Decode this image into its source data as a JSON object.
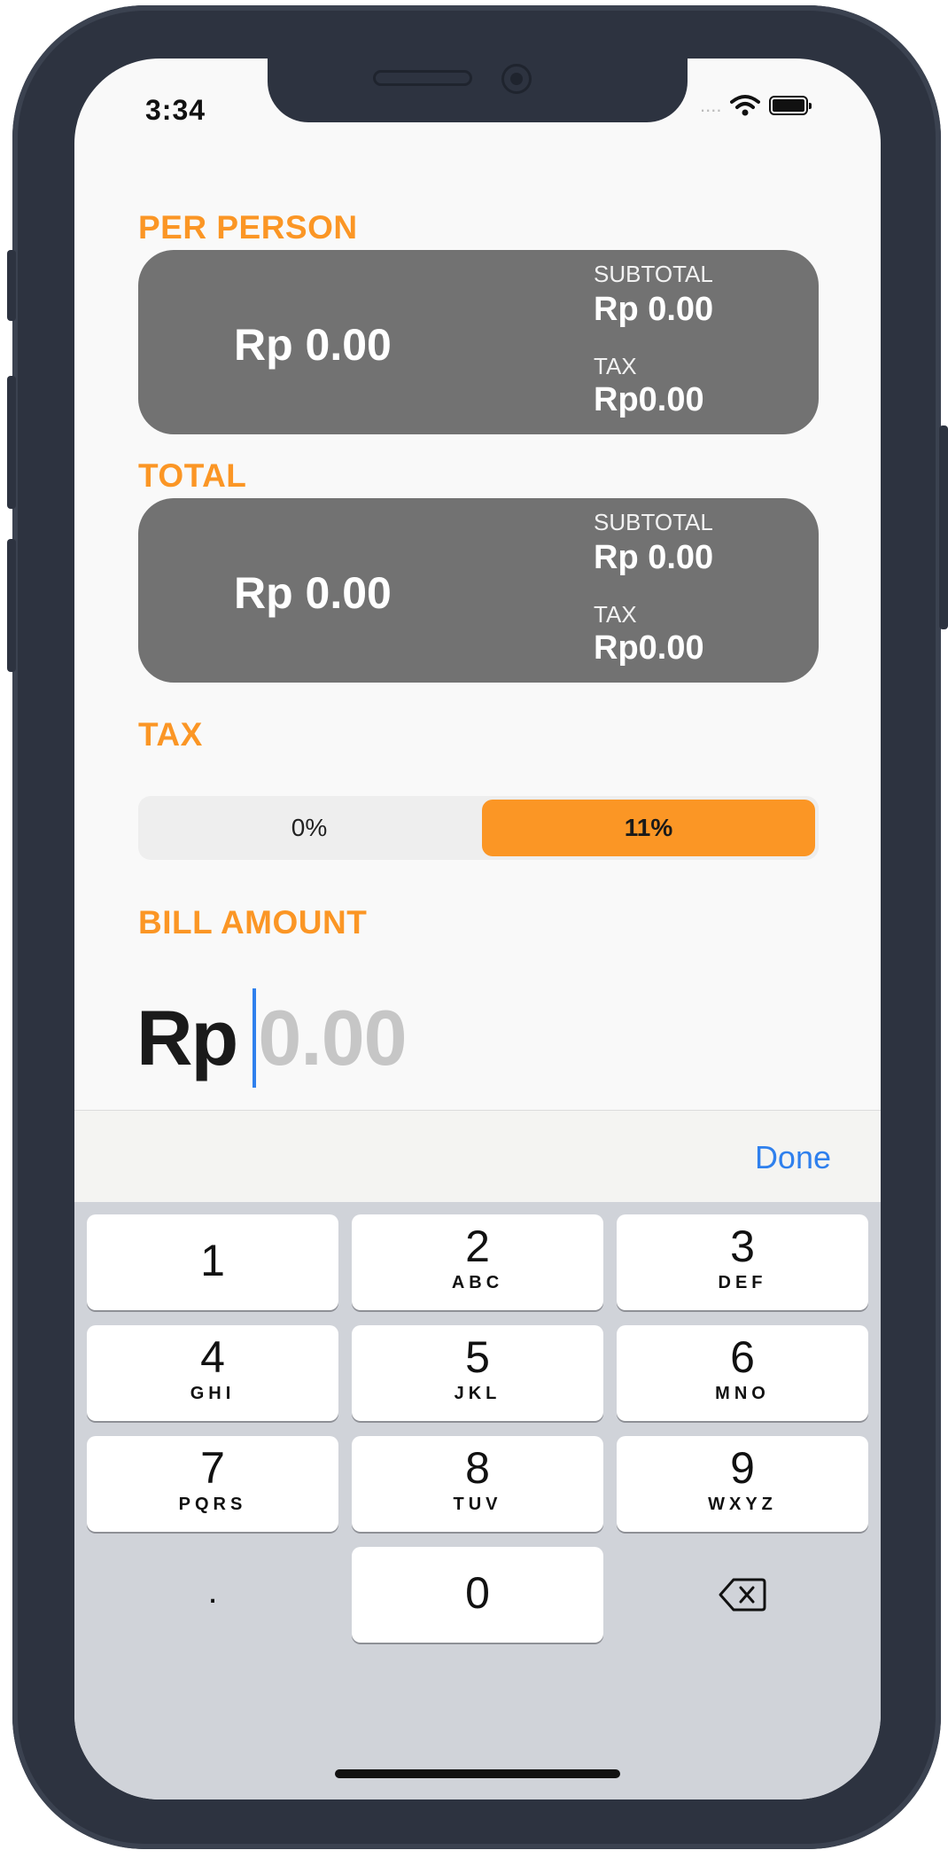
{
  "status_bar": {
    "time": "3:34",
    "signal": "....",
    "wifi_icon": "wifi-icon",
    "battery_icon": "battery-icon"
  },
  "per_person": {
    "label": "PER PERSON",
    "total": "Rp 0.00",
    "subtotal_label": "SUBTOTAL",
    "subtotal_value": "Rp 0.00",
    "tax_label": "TAX",
    "tax_value": "Rp0.00"
  },
  "total": {
    "label": "TOTAL",
    "total": "Rp 0.00",
    "subtotal_label": "SUBTOTAL",
    "subtotal_value": "Rp 0.00",
    "tax_label": "TAX",
    "tax_value": "Rp0.00"
  },
  "tax": {
    "label": "TAX",
    "options": [
      "0%",
      "11%"
    ],
    "selected": "11%"
  },
  "bill": {
    "label": "BILL AMOUNT",
    "currency": "Rp",
    "placeholder": "0.00"
  },
  "accessory": {
    "done_label": "Done"
  },
  "keypad": {
    "keys": [
      {
        "num": "1",
        "letters": ""
      },
      {
        "num": "2",
        "letters": "ABC"
      },
      {
        "num": "3",
        "letters": "DEF"
      },
      {
        "num": "4",
        "letters": "GHI"
      },
      {
        "num": "5",
        "letters": "JKL"
      },
      {
        "num": "6",
        "letters": "MNO"
      },
      {
        "num": "7",
        "letters": "PQRS"
      },
      {
        "num": "8",
        "letters": "TUV"
      },
      {
        "num": "9",
        "letters": "WXYZ"
      }
    ],
    "decimal": ".",
    "zero": "0",
    "delete_icon": "backspace-icon"
  },
  "colors": {
    "accent": "#fb9625",
    "card": "#727272",
    "link": "#2f80ed"
  }
}
